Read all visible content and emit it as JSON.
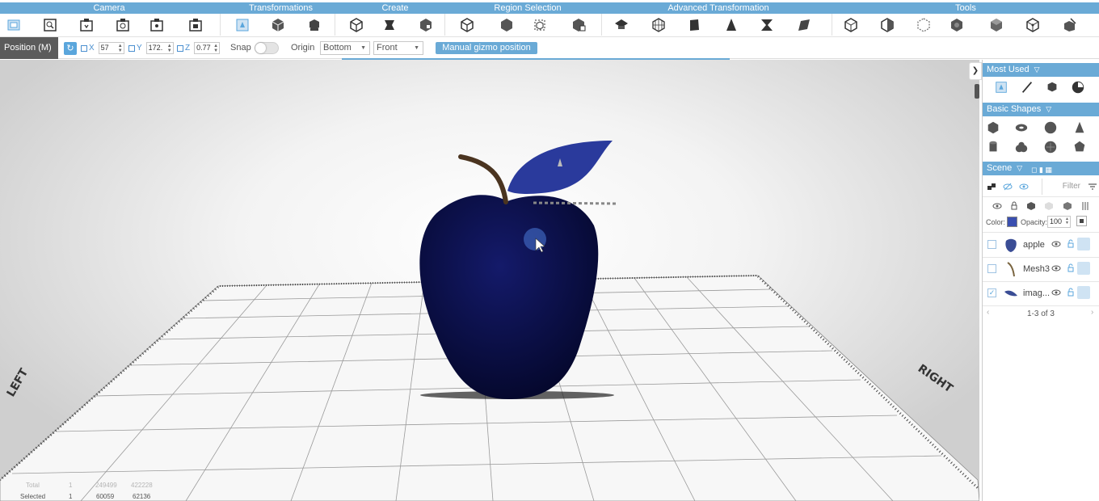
{
  "ribbon": {
    "groups": [
      {
        "name": "camera",
        "label": "Camera"
      },
      {
        "name": "transformations",
        "label": "Transformations"
      },
      {
        "name": "create",
        "label": "Create"
      },
      {
        "name": "region-selection",
        "label": "Region Selection"
      },
      {
        "name": "advanced-transformation",
        "label": "Advanced Transformation"
      },
      {
        "name": "tools",
        "label": "Tools"
      }
    ],
    "tools": [
      "select-box-icon",
      "zoom-fit-icon",
      "camera-front-icon",
      "camera-ortho-icon",
      "camera-snapshot-icon",
      "camera-frame-icon",
      "move-gizmo-icon",
      "rotate-cube-icon",
      "scale-cube-icon",
      "cube-create-icon",
      "cylinder-create-icon",
      "extrude-create-icon",
      "cube-select-icon",
      "box-select-icon",
      "lasso-select-icon",
      "grid-select-icon",
      "cap-transform-icon",
      "wire-cube-icon",
      "bend-cube-icon",
      "cone-transform-icon",
      "twist-icon",
      "slant-cube-icon",
      "measure-cube-icon",
      "half-cube-icon",
      "dotted-cube-icon",
      "sphere-tool-icon",
      "shaded-cube-icon",
      "edit-cube-icon",
      "wand-cube-icon"
    ]
  },
  "optbar": {
    "mode": "Position (M)",
    "x_label": "X",
    "x_value": "57",
    "y_label": "Y",
    "y_value": "172.",
    "z_label": "Z",
    "z_value": "0.77",
    "snap_label": "Snap",
    "origin_label": "Origin",
    "origin_value": "Bottom",
    "view_value": "Front",
    "manual_btn": "Manual gizmo position"
  },
  "viewport": {
    "label_left": "LEFT",
    "label_right": "RIGHT",
    "apple_color": "#0a0f52",
    "leaf_color": "#2a3a9c",
    "stem_color": "#5a3d22",
    "stats": {
      "total_label": "Total",
      "selected_label": "Selected",
      "total": [
        "1",
        "249499",
        "422228"
      ],
      "selected": [
        "1",
        "60059",
        "62136"
      ]
    }
  },
  "panel": {
    "most_used": "Most Used",
    "basic_shapes": "Basic Shapes",
    "scene": "Scene",
    "filter_placeholder": "Filter",
    "color_label": "Color:",
    "opacity_label": "Opacity:",
    "opacity_value": "100",
    "objects": [
      {
        "name": "apple",
        "checked": false
      },
      {
        "name": "Mesh3",
        "checked": false
      },
      {
        "name": "imag...",
        "checked": true
      }
    ],
    "pager": "1-3 of 3"
  },
  "colors": {
    "accent": "#6aaad6",
    "mode_bg": "#5b5b5b"
  }
}
